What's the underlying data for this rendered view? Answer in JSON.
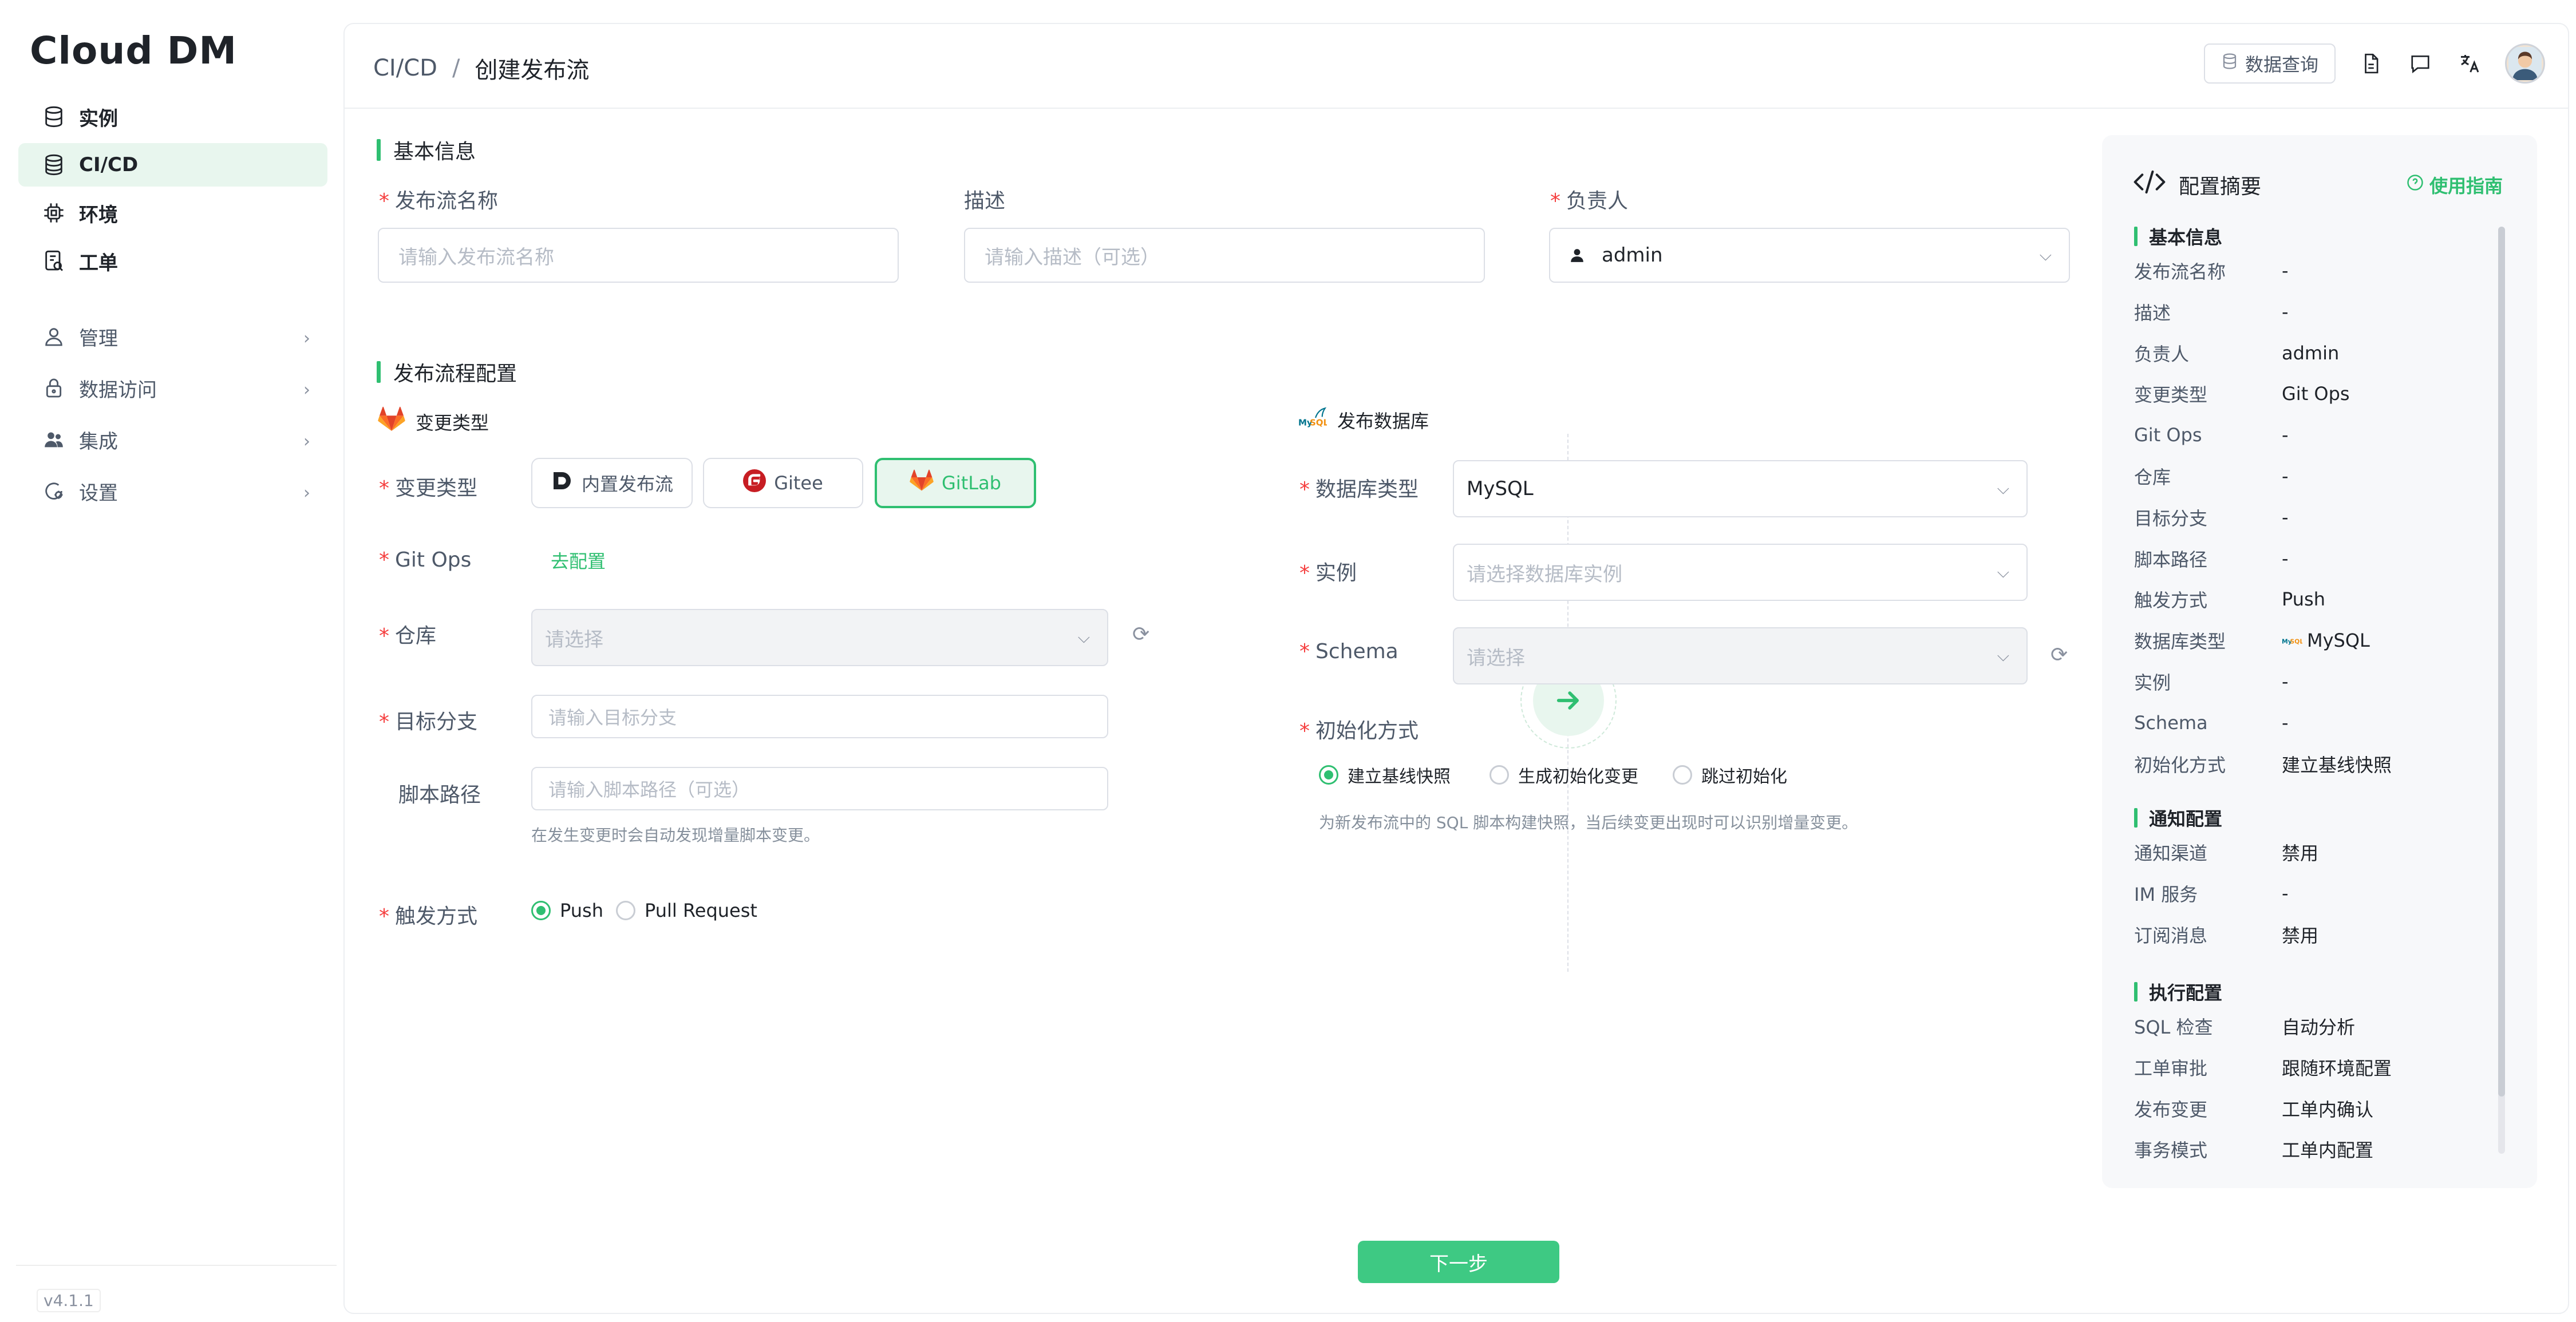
{
  "app": {
    "logo": "Cloud DM",
    "version": "v4.1.1"
  },
  "sidebar": {
    "items": [
      {
        "label": "实例",
        "icon": "database-icon"
      },
      {
        "label": "CI/CD",
        "icon": "database-stack-icon"
      },
      {
        "label": "环境",
        "icon": "chip-icon"
      },
      {
        "label": "工单",
        "icon": "ticket-icon"
      },
      {
        "label": "管理",
        "icon": "user-icon"
      },
      {
        "label": "数据访问",
        "icon": "lock-icon"
      },
      {
        "label": "集成",
        "icon": "group-icon"
      },
      {
        "label": "设置",
        "icon": "settings-icon"
      }
    ]
  },
  "header": {
    "breadcrumb_root": "CI/CD",
    "breadcrumb_sep": "/",
    "breadcrumb_current": "创建发布流",
    "query_button": "数据查询"
  },
  "basic": {
    "title": "基本信息",
    "name_label": "发布流名称",
    "name_placeholder": "请输入发布流名称",
    "desc_label": "描述",
    "desc_placeholder": "请输入描述（可选）",
    "owner_label": "负责人",
    "owner_value": "admin"
  },
  "flow": {
    "title": "发布流程配置",
    "change_section": "变更类型",
    "change_label": "变更类型",
    "options": [
      "内置发布流",
      "Gitee",
      "GitLab"
    ],
    "gitops_label": "Git Ops",
    "gitops_link": "去配置",
    "repo_label": "仓库",
    "repo_placeholder": "请选择",
    "branch_label": "目标分支",
    "branch_placeholder": "请输入目标分支",
    "script_label": "脚本路径",
    "script_placeholder": "请输入脚本路径（可选）",
    "script_hint": "在发生变更时会自动发现增量脚本变更。",
    "trigger_label": "触发方式",
    "trigger_push": "Push",
    "trigger_pr": "Pull Request",
    "db_section": "发布数据库",
    "dbtype_label": "数据库类型",
    "dbtype_value": "MySQL",
    "instance_label": "实例",
    "instance_placeholder": "请选择数据库实例",
    "schema_label": "Schema",
    "schema_placeholder": "请选择",
    "init_label": "初始化方式",
    "init_opt1": "建立基线快照",
    "init_opt2": "生成初始化变更",
    "init_opt3": "跳过初始化",
    "init_hint": "为新发布流中的 SQL 脚本构建快照，当后续变更出现时可以识别增量变更。"
  },
  "next_button": "下一步",
  "summary": {
    "title": "配置摘要",
    "guide": "使用指南",
    "sec_basic": "基本信息",
    "sec_notify": "通知配置",
    "sec_exec": "执行配置",
    "basic_rows": [
      {
        "k": "发布流名称",
        "v": "-"
      },
      {
        "k": "描述",
        "v": "-"
      },
      {
        "k": "负责人",
        "v": "admin"
      },
      {
        "k": "变更类型",
        "v": "Git Ops"
      },
      {
        "k": "Git Ops",
        "v": "-"
      },
      {
        "k": "仓库",
        "v": "-"
      },
      {
        "k": "目标分支",
        "v": "-"
      },
      {
        "k": "脚本路径",
        "v": "-"
      },
      {
        "k": "触发方式",
        "v": "Push"
      },
      {
        "k": "数据库类型",
        "v": "MySQL"
      },
      {
        "k": "实例",
        "v": "-"
      },
      {
        "k": "Schema",
        "v": "-"
      },
      {
        "k": "初始化方式",
        "v": "建立基线快照"
      }
    ],
    "notify_rows": [
      {
        "k": "通知渠道",
        "v": "禁用"
      },
      {
        "k": "IM 服务",
        "v": "-"
      },
      {
        "k": "订阅消息",
        "v": "禁用"
      }
    ],
    "exec_rows": [
      {
        "k": "SQL 检查",
        "v": "自动分析"
      },
      {
        "k": "工单审批",
        "v": "跟随环境配置"
      },
      {
        "k": "发布变更",
        "v": "工单内确认"
      },
      {
        "k": "事务模式",
        "v": "工单内配置"
      }
    ]
  },
  "colors": {
    "accent": "#2fbf71",
    "required": "#f53f3f",
    "gitlab": "#e2432a",
    "gitee": "#c71d23"
  }
}
